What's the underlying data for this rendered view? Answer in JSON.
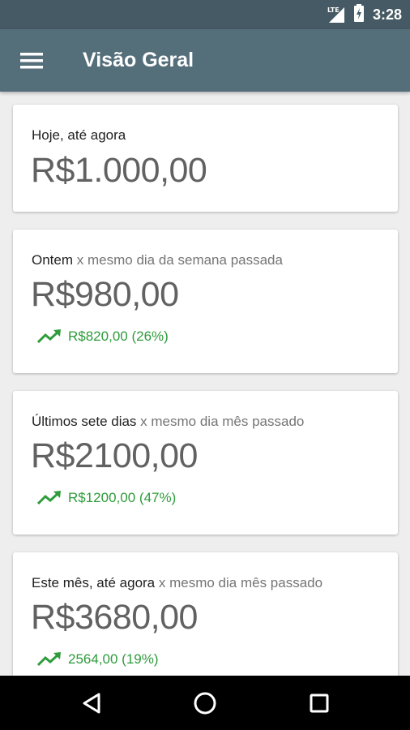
{
  "status_bar": {
    "network": "LTE",
    "time": "3:28"
  },
  "app_bar": {
    "title": "Visão Geral",
    "menu_icon": "hamburger-menu-icon"
  },
  "cards": [
    {
      "label": "Hoje, até agora",
      "comparison": "",
      "value": "R$1.000,00"
    },
    {
      "label": "Ontem",
      "comparison": "x mesmo dia da semana passada",
      "value": "R$980,00",
      "trend": "R$820,00 (26%)",
      "trend_icon": "trending-up-icon"
    },
    {
      "label": "Últimos sete dias",
      "comparison": "x mesmo dia mês passado",
      "value": "R$2100,00",
      "trend": "R$1200,00 (47%)",
      "trend_icon": "trending-up-icon"
    },
    {
      "label": "Este mês, até agora",
      "comparison": "x mesmo dia mês passado",
      "value": "R$3680,00",
      "trend": "2564,00 (19%)",
      "trend_icon": "trending-up-icon"
    }
  ],
  "colors": {
    "status_bar": "#455a64",
    "app_bar": "#546e7a",
    "trend_positive": "#2e9c3b",
    "value_text": "#616161",
    "background": "#eeeeee"
  },
  "nav_bar": {
    "back_icon": "back-triangle-icon",
    "home_icon": "home-circle-icon",
    "recents_icon": "recents-square-icon"
  }
}
